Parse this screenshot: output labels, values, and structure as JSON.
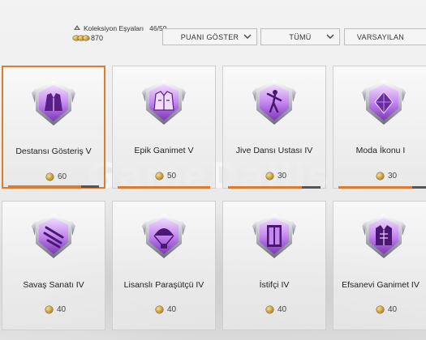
{
  "header": {
    "collection_label": "Koleksiyon Eşyaları",
    "collection_count": "46/59",
    "points": "870"
  },
  "filters": [
    {
      "label": "PUANI GÖSTER"
    },
    {
      "label": "TÜMÜ"
    },
    {
      "label": "VARSAYILAN"
    }
  ],
  "watermark": "GameDailis",
  "cards": [
    {
      "name": "Destansı Gösteriş V",
      "points": "60",
      "progress": 0.8,
      "icon": "jacket-emblem-icon",
      "selected": true
    },
    {
      "name": "Epik Ganimet V",
      "points": "50",
      "progress": 1.0,
      "icon": "vest-emblem-icon",
      "selected": false
    },
    {
      "name": "Jive Dansı Ustası IV",
      "points": "30",
      "progress": 0.8,
      "icon": "dancer-emblem-icon",
      "selected": false
    },
    {
      "name": "Moda İkonu I",
      "points": "30",
      "progress": 0.8,
      "icon": "diamond-emblem-icon",
      "selected": false
    },
    {
      "name": "Savaş Sanatı IV",
      "points": "40",
      "icon": "claw-marks-emblem-icon",
      "selected": false
    },
    {
      "name": "Lisanslı Paraşütçü IV",
      "points": "40",
      "icon": "parachute-emblem-icon",
      "selected": false
    },
    {
      "name": "İstifçi IV",
      "points": "40",
      "icon": "locker-emblem-icon",
      "selected": false
    },
    {
      "name": "Efsanevi Ganimet IV",
      "points": "40",
      "icon": "armor-emblem-icon",
      "selected": false
    }
  ],
  "colors": {
    "accent": "#e07b2c",
    "emblem_purple": "#a25ad6",
    "emblem_light": "#e9c8ff"
  }
}
